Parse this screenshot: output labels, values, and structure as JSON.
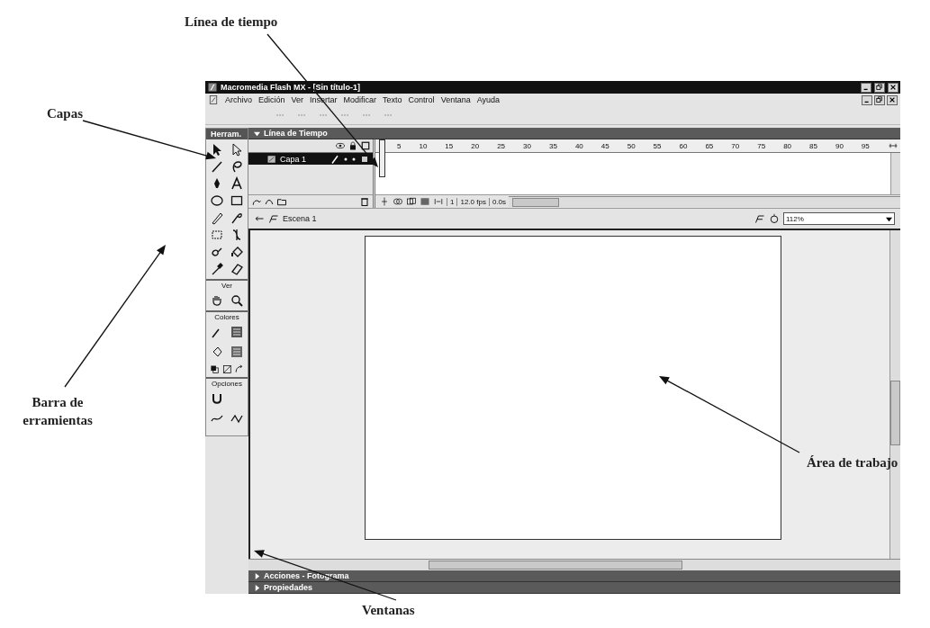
{
  "annotations": [
    {
      "label": "Línea de tiempo"
    },
    {
      "label": "Capas"
    },
    {
      "label": "Barra de erramientas"
    },
    {
      "label": "Área de trabajo"
    },
    {
      "label": "Ventanas"
    }
  ],
  "window": {
    "title": "Macromedia Flash MX - [Sin título-1]"
  },
  "menu": [
    "Archivo",
    "Edición",
    "Ver",
    "Insertar",
    "Modificar",
    "Texto",
    "Control",
    "Ventana",
    "Ayuda"
  ],
  "tools_panel": {
    "title": "Herram.",
    "section_headings": [
      "Ver",
      "Colores",
      "Opciones"
    ]
  },
  "timeline": {
    "title": "Línea de Tiempo",
    "expanded": true,
    "layers": [
      {
        "name": "Capa 1",
        "selected": true
      }
    ],
    "ruler": [
      "5",
      "10",
      "15",
      "20",
      "25",
      "30",
      "35",
      "40",
      "45",
      "50",
      "55",
      "60",
      "65",
      "70",
      "75",
      "80",
      "85",
      "90",
      "95"
    ],
    "current_frame": "1",
    "frame_rate": "12.0 fps",
    "elapsed": "0.0s"
  },
  "scene": {
    "name": "Escena 1",
    "zoom": "112%"
  },
  "panels": [
    {
      "title": "Acciones - Fotograma",
      "expanded": false
    },
    {
      "title": "Propiedades",
      "expanded": false
    }
  ]
}
